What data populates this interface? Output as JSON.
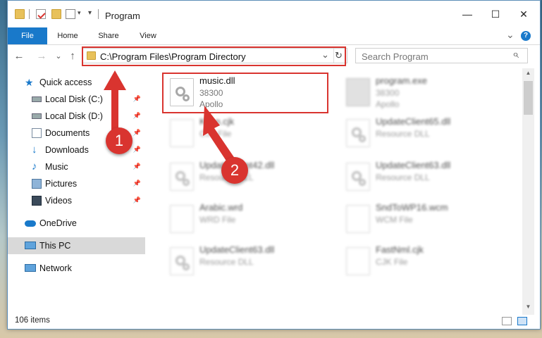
{
  "window": {
    "title": "Program",
    "controls": {
      "minimize": "—",
      "maximize": "☐",
      "close": "✕"
    }
  },
  "ribbon": {
    "tabs": [
      "File",
      "Home",
      "Share",
      "View"
    ],
    "expand_icon": "⌄",
    "help_icon": "?"
  },
  "address": {
    "path": "C:\\Program Files\\Program Directory",
    "dropdown_icon": "⌄",
    "refresh_icon": "↻"
  },
  "search": {
    "placeholder": "Search Program",
    "icon": "⌕"
  },
  "nav": {
    "back": "←",
    "forward": "→",
    "recent": "⌄",
    "up": "↑",
    "items": [
      {
        "label": "Quick access",
        "icon": "star-icon"
      },
      {
        "label": "Local Disk (C:)",
        "icon": "drive-icon",
        "pinned": true
      },
      {
        "label": "Local Disk (D:)",
        "icon": "drive-icon",
        "pinned": true
      },
      {
        "label": "Documents",
        "icon": "documents-icon",
        "pinned": true
      },
      {
        "label": "Downloads",
        "icon": "downloads-icon",
        "pinned": true
      },
      {
        "label": "Music",
        "icon": "music-icon",
        "pinned": true
      },
      {
        "label": "Pictures",
        "icon": "pictures-icon",
        "pinned": true
      },
      {
        "label": "Videos",
        "icon": "videos-icon",
        "pinned": true
      },
      {
        "label": "OneDrive",
        "icon": "cloud-icon"
      },
      {
        "label": "This PC",
        "icon": "computer-icon",
        "selected": true
      },
      {
        "label": "Network",
        "icon": "network-icon"
      }
    ]
  },
  "files": [
    {
      "name": "music.dll",
      "line2": "38300",
      "line3": "Apollo"
    },
    {
      "name": "program.exe",
      "line2": "38300",
      "line3": "Apollo"
    },
    {
      "name": "Ki...n.cjk",
      "line2": "CJK File",
      "line3": ""
    },
    {
      "name": "UpdateClient65.dll",
      "line2": "Resource DLL",
      "line3": ""
    },
    {
      "name": "UpdateClient42.dll",
      "line2": "Resource DLL",
      "line3": ""
    },
    {
      "name": "UpdateClient63.dll",
      "line2": "Resource DLL",
      "line3": ""
    },
    {
      "name": "Arabic.wrd",
      "line2": "WRD File",
      "line3": ""
    },
    {
      "name": "SndToWP16.wcm",
      "line2": "WCM File",
      "line3": ""
    },
    {
      "name": "UpdateClient63.dll",
      "line2": "Resource DLL",
      "line3": ""
    },
    {
      "name": "FastNml.cjk",
      "line2": "CJK File",
      "line3": ""
    }
  ],
  "status": {
    "count": "106 items"
  },
  "callouts": {
    "one": "1",
    "two": "2"
  },
  "colors": {
    "accent": "#1979ca",
    "callout": "#d9342f"
  }
}
